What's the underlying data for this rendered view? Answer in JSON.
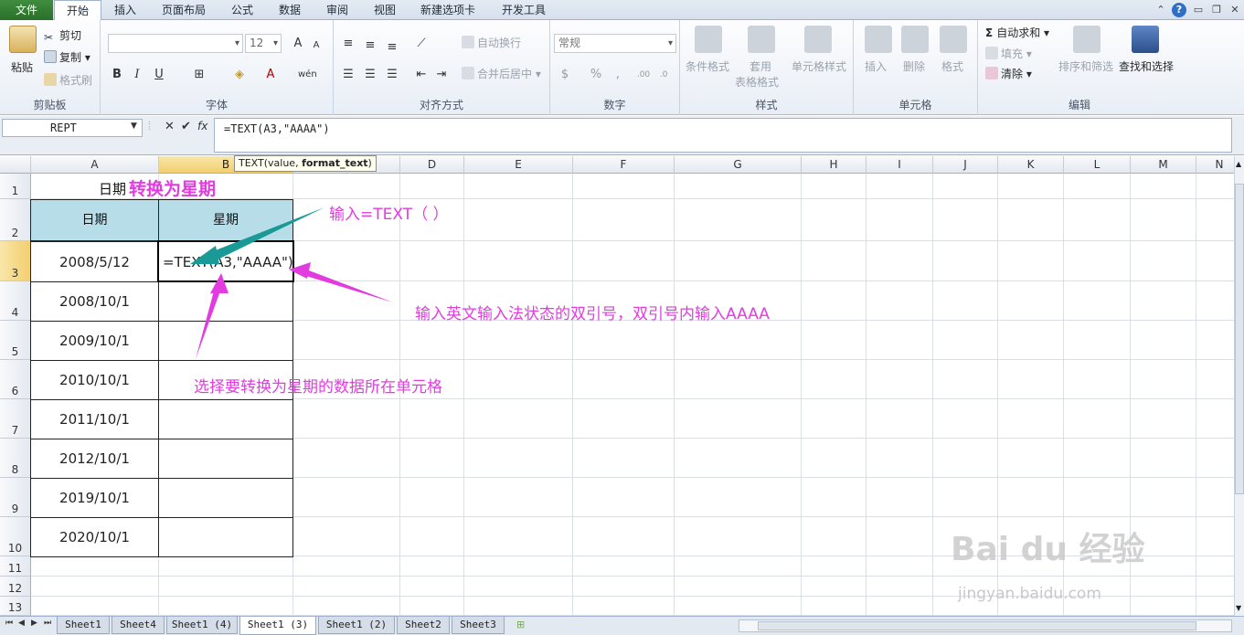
{
  "ribbon_tabs": [
    "文件",
    "开始",
    "插入",
    "页面布局",
    "公式",
    "数据",
    "审阅",
    "视图",
    "新建选项卡",
    "开发工具"
  ],
  "clipboard": {
    "paste": "粘贴",
    "cut": "剪切",
    "copy": "复制",
    "format_painter": "格式刷",
    "title": "剪贴板"
  },
  "font": {
    "size": "12",
    "bold": "B",
    "italic": "I",
    "underline": "U",
    "title": "字体"
  },
  "alignment": {
    "wrap": "自动换行",
    "merge": "合并后居中",
    "title": "对齐方式"
  },
  "number": {
    "format": "常规",
    "title": "数字"
  },
  "styles": {
    "cond": "条件格式",
    "table1": "套用",
    "table2": "表格格式",
    "cell": "单元格样式",
    "title": "样式"
  },
  "cells": {
    "insert": "插入",
    "delete": "删除",
    "format": "格式",
    "title": "单元格"
  },
  "editing": {
    "autosum": "自动求和",
    "fill": "填充",
    "clear": "清除",
    "sort": "排序和筛选",
    "find": "查找和选择",
    "title": "编辑"
  },
  "formula_bar": {
    "name_box": "REPT",
    "fx": "fx",
    "formula": "=TEXT(A3,\"AAAA\")"
  },
  "tooltip": {
    "prefix": "TEXT(value, ",
    "bold": "format_text",
    "suffix": ")"
  },
  "columns": [
    "A",
    "B",
    "C",
    "D",
    "E",
    "F",
    "G",
    "H",
    "I",
    "J",
    "K",
    "L",
    "M",
    "N"
  ],
  "rows": [
    "1",
    "2",
    "3",
    "4",
    "5",
    "6",
    "7",
    "8",
    "9",
    "10",
    "11",
    "12",
    "13"
  ],
  "sheet": {
    "title_plain": "日期",
    "title_highlight": "转换为星期",
    "header_date": "日期",
    "header_week": "星期",
    "dates": [
      "2008/5/12",
      "2008/10/1",
      "2009/10/1",
      "2010/10/1",
      "2011/10/1",
      "2012/10/1",
      "2019/10/1",
      "2020/10/1"
    ],
    "active_cell_text": "=TEXT(A3,\"AAAA\")"
  },
  "annotations": {
    "a1": "输入=TEXT（ ）",
    "a2": "输入英文输入法状态的双引号，双引号内输入AAAA",
    "a3": "选择要转换为星期的数据所在单元格",
    "color": "#e23ce0",
    "arrow_teal": "#1a9a96"
  },
  "sheet_tabs": [
    "Sheet1",
    "Sheet4",
    "Sheet1 (4)",
    "Sheet1 (3)",
    "Sheet1 (2)",
    "Sheet2",
    "Sheet3"
  ],
  "active_sheet": "Sheet1 (3)",
  "watermark": {
    "brand": "Bai du 经验",
    "url": "jingyan.baidu.com"
  }
}
